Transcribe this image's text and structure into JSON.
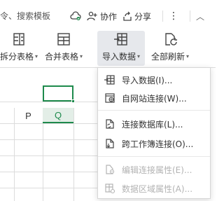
{
  "topbar": {
    "search_hint": "令、搜索模板",
    "collab_label": "协作",
    "share_label": "分享",
    "more_label": "⋮",
    "collapse_label": "︿"
  },
  "ribbon": {
    "split_table": "拆分表格",
    "merge_table": "合并表格",
    "import_data": "导入数据",
    "refresh_all": "全部刷新"
  },
  "sheet": {
    "col_p": "P",
    "col_q": "Q"
  },
  "menu": {
    "items": [
      {
        "label": "导入数据(I)...",
        "enabled": true
      },
      {
        "label": "自网站连接(W)...",
        "enabled": true
      },
      {
        "label": "连接数据库(L)...",
        "enabled": true
      },
      {
        "label": "跨工作簿连接(O)...",
        "enabled": true
      },
      {
        "label": "编辑连接属性(E)...",
        "enabled": false
      },
      {
        "label": "数据区域属性(A)...",
        "enabled": false
      }
    ]
  },
  "colors": {
    "accent": "#1e8a4c",
    "disabled_text": "#b3b3b3"
  }
}
